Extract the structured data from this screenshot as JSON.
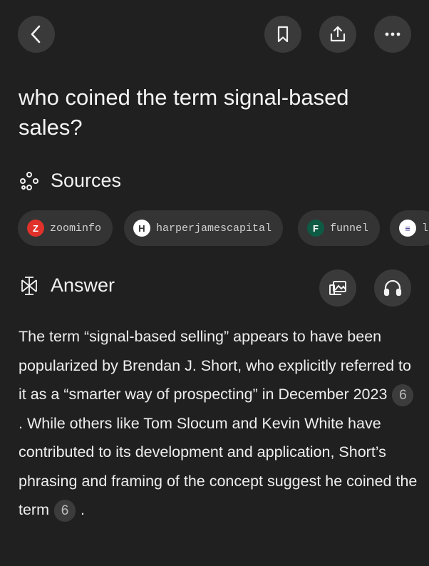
{
  "header": {
    "back_icon": "chevron-left-icon",
    "bookmark_icon": "bookmark-icon",
    "share_icon": "share-icon",
    "more_icon": "more-horizontal-icon"
  },
  "question": "who coined the term signal-based sales?",
  "sources": {
    "title": "Sources",
    "icon": "sources-icon",
    "items": [
      {
        "label": "zoominfo",
        "favicon_color": "#e0322b",
        "favicon_glyph": "Z"
      },
      {
        "label": "harperjamescapital",
        "favicon_color": "#ffffff",
        "favicon_glyph": "H"
      },
      {
        "label": "funnel",
        "favicon_color": "#0f5a45",
        "favicon_glyph": "F"
      },
      {
        "label": "l",
        "favicon_color": "#ffffff",
        "favicon_glyph": "≡"
      }
    ]
  },
  "answer": {
    "title": "Answer",
    "icon": "answer-icon",
    "gallery_icon": "image-gallery-icon",
    "listen_icon": "headphones-icon",
    "segments": [
      "The term “signal-based selling” appears to have been popularized by Brendan J. Short, who explicitly referred to it as a “smarter way of prospecting” in December 2023",
      ". While others like Tom Slocum and Kevin White have contributed to its development and application, Short’s phrasing and framing of the concept suggest he coined the term",
      "."
    ],
    "citations": [
      "6",
      "6"
    ]
  },
  "colors": {
    "background": "#202020",
    "button": "#3a3a3a",
    "chip": "#343434",
    "text": "#f2f2f2"
  }
}
